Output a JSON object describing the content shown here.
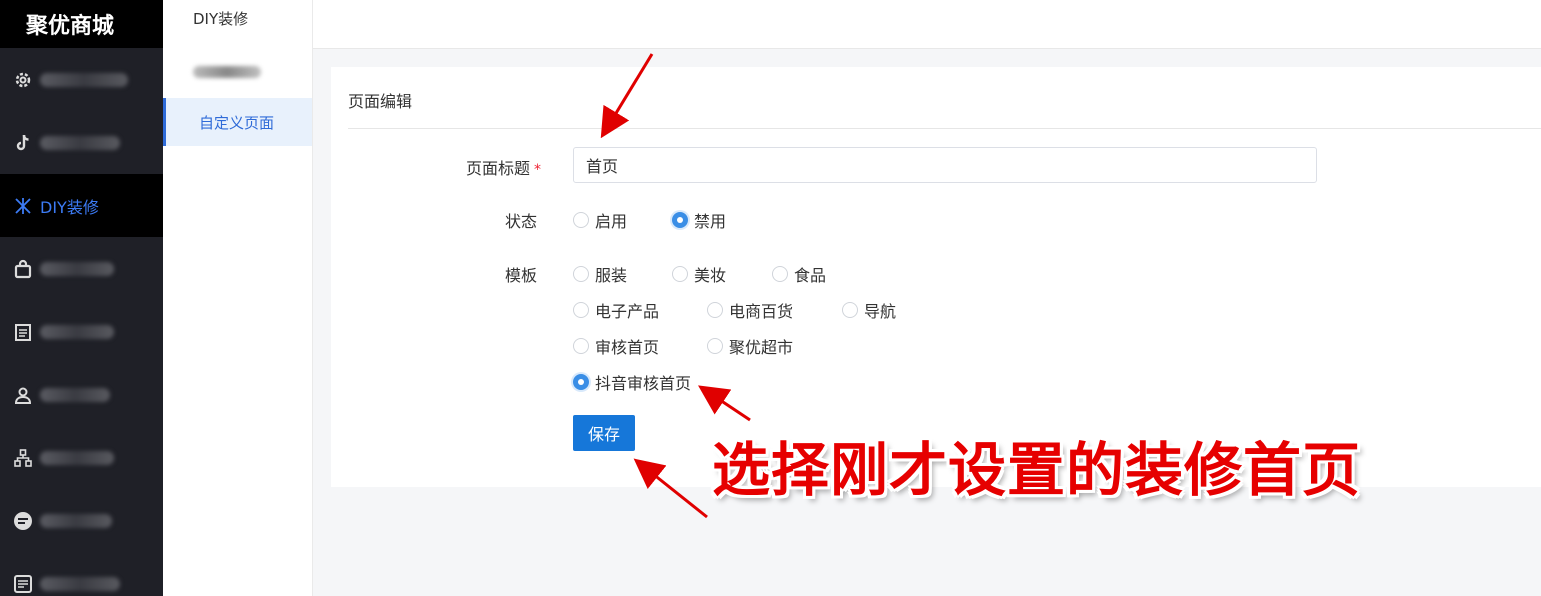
{
  "app": {
    "brand": "聚优商城"
  },
  "sidebar": {
    "items": [
      {
        "label": "",
        "icon": "gear-icon",
        "active": false
      },
      {
        "label": "",
        "icon": "tiktok-icon",
        "active": false
      },
      {
        "label": "DIY装修",
        "icon": "diy-icon",
        "active": true
      },
      {
        "label": "",
        "icon": "bag-icon",
        "active": false
      },
      {
        "label": "",
        "icon": "clipboard-icon",
        "active": false
      },
      {
        "label": "",
        "icon": "user-icon",
        "active": false
      },
      {
        "label": "",
        "icon": "org-icon",
        "active": false
      },
      {
        "label": "",
        "icon": "chat-icon",
        "active": false
      },
      {
        "label": "",
        "icon": "list-icon",
        "active": false
      }
    ]
  },
  "subnav": {
    "title": "DIY装修",
    "active_item": "自定义页面"
  },
  "card": {
    "title": "页面编辑"
  },
  "form": {
    "title_label": "页面标题",
    "required_mark": "*",
    "title_value": "首页",
    "status_label": "状态",
    "status_options": [
      {
        "label": "启用",
        "checked": false
      },
      {
        "label": "禁用",
        "checked": true
      }
    ],
    "template_label": "模板",
    "template_options": [
      {
        "label": "服装",
        "checked": false
      },
      {
        "label": "美妆",
        "checked": false
      },
      {
        "label": "食品",
        "checked": false
      },
      {
        "label": "电子产品",
        "checked": false
      },
      {
        "label": "电商百货",
        "checked": false
      },
      {
        "label": "导航",
        "checked": false
      },
      {
        "label": "审核首页",
        "checked": false
      },
      {
        "label": "聚优超市",
        "checked": false
      },
      {
        "label": "抖音审核首页",
        "checked": true
      }
    ],
    "save_label": "保存"
  },
  "annotation": {
    "callout_text": "选择刚才设置的装修首页",
    "arrow_color": "#e00000"
  }
}
